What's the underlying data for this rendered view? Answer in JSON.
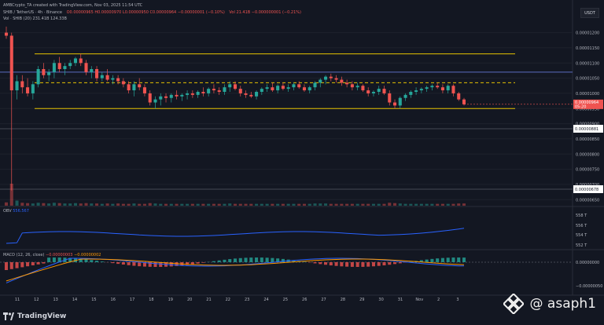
{
  "header": {
    "attribution": "AMBCrypto_TA created with TradingView.com, Nov 03, 2025 11:54 UTC",
    "symbol_line": "SHIB / TetherUS · 4h · Binance",
    "ohlc": "O0.00000965  H0.00000970  L0.00000950  C0.00000964  −0.00000001 (−0.10%)",
    "extra": "Vol 21.41B  −0.000000001 (−0.21%)",
    "vol_line": "Vol · SHIB (20)  231.41B  124.33B"
  },
  "currency_button": "USDT",
  "price_axis": {
    "ticks": [
      "0.00001200",
      "0.00001150",
      "0.00001100",
      "0.00001050",
      "0.00001000",
      "0.00000950",
      "0.00000900",
      "0.00000850",
      "0.00000800",
      "0.00000750",
      "0.00000700",
      "0.00000650"
    ],
    "current_price_label": "0.00000964",
    "current_time_label": "05:20",
    "marker_upper": "0.00000881",
    "marker_lower": "0.00000678"
  },
  "obv": {
    "label": "OBV",
    "value": "556.567",
    "ticks": [
      "558 T",
      "556 T",
      "554 T",
      "552 T"
    ]
  },
  "macd": {
    "label": "MACD (12, 26, close)",
    "value1": "−0.00000003",
    "value2": "−0.00000002",
    "zero_tick": "0.00000000",
    "low_tick": "−0.00000050"
  },
  "time_axis": [
    "11",
    "12",
    "13",
    "14",
    "15",
    "16",
    "17",
    "18",
    "19",
    "20",
    "21",
    "22",
    "23",
    "24",
    "25",
    "26",
    "27",
    "28",
    "29",
    "30",
    "31",
    "Nov",
    "2",
    "3"
  ],
  "footer": {
    "brand": "TradingView"
  },
  "watermark": {
    "handle": "@ asaph1"
  },
  "colors": {
    "up": "#26a69a",
    "down": "#ef5350",
    "level": "#e5c200",
    "blue_line": "#5c6bc0",
    "obv": "#2962ff",
    "bg": "#131722"
  },
  "chart_data": {
    "type": "candlestick",
    "title": "SHIB / TetherUS · 4h · Binance",
    "ylim": [
      6.3e-06,
      1.23e-05
    ],
    "levels": {
      "resistance_upper": 1.13e-05,
      "horizontal_blue": 1.07e-05,
      "dashed_mid": 1.035e-05,
      "support_lower": 9.5e-06
    },
    "candles": [
      [
        1.2e-05,
        1.22e-05,
        1.18e-05,
        1.19e-05
      ],
      [
        1.19e-05,
        1.2e-05,
        6.8e-06,
        1.01e-05
      ],
      [
        1.01e-05,
        1.06e-05,
        9.8e-06,
        1.04e-05
      ],
      [
        1.04e-05,
        1.06e-05,
        1e-05,
        1.02e-05
      ],
      [
        1.02e-05,
        1.05e-05,
        9.9e-06,
        1e-05
      ],
      [
        1e-05,
        1.04e-05,
        9.8e-06,
        1.03e-05
      ],
      [
        1.03e-05,
        1.09e-05,
        1.02e-05,
        1.08e-05
      ],
      [
        1.08e-05,
        1.1e-05,
        1.05e-05,
        1.06e-05
      ],
      [
        1.06e-05,
        1.08e-05,
        1.04e-05,
        1.07e-05
      ],
      [
        1.07e-05,
        1.11e-05,
        1.05e-05,
        1.1e-05
      ],
      [
        1.1e-05,
        1.12e-05,
        1.07e-05,
        1.08e-05
      ],
      [
        1.08e-05,
        1.1e-05,
        1.06e-05,
        1.09e-05
      ],
      [
        1.09e-05,
        1.11e-05,
        1.08e-05,
        1.1e-05
      ],
      [
        1.1e-05,
        1.12e-05,
        1.09e-05,
        1.115e-05
      ],
      [
        1.115e-05,
        1.13e-05,
        1.09e-05,
        1.1e-05
      ],
      [
        1.1e-05,
        1.11e-05,
        1.06e-05,
        1.07e-05
      ],
      [
        1.07e-05,
        1.09e-05,
        1.05e-05,
        1.08e-05
      ],
      [
        1.08e-05,
        1.09e-05,
        1.04e-05,
        1.05e-05
      ],
      [
        1.05e-05,
        1.07e-05,
        1.04e-05,
        1.06e-05
      ],
      [
        1.06e-05,
        1.08e-05,
        1.04e-05,
        1.045e-05
      ],
      [
        1.045e-05,
        1.06e-05,
        1.03e-05,
        1.05e-05
      ],
      [
        1.05e-05,
        1.06e-05,
        1.03e-05,
        1.04e-05
      ],
      [
        1.04e-05,
        1.05e-05,
        1.02e-05,
        1.03e-05
      ],
      [
        1.03e-05,
        1.04e-05,
        1e-05,
        1.01e-05
      ],
      [
        1.01e-05,
        1.04e-05,
        9.9e-06,
        1.03e-05
      ],
      [
        1.03e-05,
        1.05e-05,
        1.01e-05,
        1.02e-05
      ],
      [
        1.02e-05,
        1.03e-05,
        9.9e-06,
        1e-05
      ],
      [
        1e-05,
        1.01e-05,
        9.6e-06,
        9.7e-06
      ],
      [
        9.7e-06,
        9.9e-06,
        9.5e-06,
        9.8e-06
      ],
      [
        9.8e-06,
        1e-05,
        9.6e-06,
        9.9e-06
      ],
      [
        9.9e-06,
        1e-05,
        9.7e-06,
        9.85e-06
      ],
      [
        9.85e-06,
        1e-05,
        9.7e-06,
        9.95e-06
      ],
      [
        9.95e-06,
        1.01e-05,
        9.8e-06,
        9.9e-06
      ],
      [
        9.9e-06,
        1e-05,
        9.75e-06,
        9.95e-06
      ],
      [
        9.95e-06,
        1.01e-05,
        9.8e-06,
        1e-05
      ],
      [
        1e-05,
        1.01e-05,
        9.85e-06,
        9.95e-06
      ],
      [
        9.95e-06,
        1.01e-05,
        9.85e-06,
        1.005e-05
      ],
      [
        1.005e-05,
        1.02e-05,
        9.9e-06,
        1e-05
      ],
      [
        1e-05,
        1.02e-05,
        9.9e-06,
        1.015e-05
      ],
      [
        1.015e-05,
        1.03e-05,
        1e-05,
        1.01e-05
      ],
      [
        1.01e-05,
        1.02e-05,
        9.95e-06,
        1.005e-05
      ],
      [
        1.005e-05,
        1.03e-05,
        9.95e-06,
        1.02e-05
      ],
      [
        1.02e-05,
        1.04e-05,
        1.005e-05,
        1.03e-05
      ],
      [
        1.03e-05,
        1.04e-05,
        1.01e-05,
        1.015e-05
      ],
      [
        1.015e-05,
        1.025e-05,
        9.9e-06,
        1e-05
      ],
      [
        1e-05,
        1.01e-05,
        9.85e-06,
        9.95e-06
      ],
      [
        9.95e-06,
        1.005e-05,
        9.85e-06,
        9.9e-06
      ],
      [
        9.9e-06,
        1.01e-05,
        9.8e-06,
        1.005e-05
      ],
      [
        1.005e-05,
        1.02e-05,
        9.95e-06,
        1.015e-05
      ],
      [
        1.015e-05,
        1.03e-05,
        1.005e-05,
        1.02e-05
      ],
      [
        1.02e-05,
        1.035e-05,
        1.005e-05,
        1.01e-05
      ],
      [
        1.01e-05,
        1.03e-05,
        1e-05,
        1.025e-05
      ],
      [
        1.025e-05,
        1.035e-05,
        1.01e-05,
        1.015e-05
      ],
      [
        1.015e-05,
        1.03e-05,
        1.005e-05,
        1.02e-05
      ],
      [
        1.02e-05,
        1.035e-05,
        1.01e-05,
        1.03e-05
      ],
      [
        1.03e-05,
        1.04e-05,
        1.015e-05,
        1.02e-05
      ],
      [
        1.02e-05,
        1.03e-05,
        1.005e-05,
        1.01e-05
      ],
      [
        1.01e-05,
        1.025e-05,
        1e-05,
        1.02e-05
      ],
      [
        1.02e-05,
        1.04e-05,
        1.01e-05,
        1.035e-05
      ],
      [
        1.035e-05,
        1.05e-05,
        1.02e-05,
        1.045e-05
      ],
      [
        1.045e-05,
        1.06e-05,
        1.03e-05,
        1.055e-05
      ],
      [
        1.055e-05,
        1.065e-05,
        1.04e-05,
        1.05e-05
      ],
      [
        1.05e-05,
        1.06e-05,
        1.035e-05,
        1.045e-05
      ],
      [
        1.045e-05,
        1.055e-05,
        1.025e-05,
        1.035e-05
      ],
      [
        1.035e-05,
        1.045e-05,
        1.02e-05,
        1.03e-05
      ],
      [
        1.03e-05,
        1.04e-05,
        1.01e-05,
        1.02e-05
      ],
      [
        1.02e-05,
        1.035e-05,
        1.01e-05,
        1.025e-05
      ],
      [
        1.025e-05,
        1.03e-05,
        1.005e-05,
        1.01e-05
      ],
      [
        1.01e-05,
        1.02e-05,
        9.9e-06,
        1e-05
      ],
      [
        1e-05,
        1.01e-05,
        9.9e-06,
        1.005e-05
      ],
      [
        1.005e-05,
        1.025e-05,
        9.95e-06,
        1.015e-05
      ],
      [
        1.015e-05,
        1.025e-05,
        9.95e-06,
        1e-05
      ],
      [
        1e-05,
        1.01e-05,
        9.6e-06,
        9.7e-06
      ],
      [
        9.7e-06,
        9.8e-06,
        9.5e-06,
        9.6e-06
      ],
      [
        9.6e-06,
        9.9e-06,
        9.5e-06,
        9.85e-06
      ],
      [
        9.85e-06,
        1e-05,
        9.75e-06,
        9.95e-06
      ],
      [
        9.95e-06,
        1.01e-05,
        9.85e-06,
        1.005e-05
      ],
      [
        1.005e-05,
        1.02e-05,
        9.95e-06,
        1.01e-05
      ],
      [
        1.01e-05,
        1.02e-05,
        1e-05,
        1.015e-05
      ],
      [
        1.015e-05,
        1.025e-05,
        1.005e-05,
        1.02e-05
      ],
      [
        1.02e-05,
        1.03e-05,
        1.01e-05,
        1.025e-05
      ],
      [
        1.025e-05,
        1.035e-05,
        1.015e-05,
        1.02e-05
      ],
      [
        1.02e-05,
        1.03e-05,
        1e-05,
        1.01e-05
      ],
      [
        1.01e-05,
        1.03e-05,
        1e-05,
        1.025e-05
      ],
      [
        1.025e-05,
        1.03e-05,
        9.9e-06,
        1e-05
      ],
      [
        1e-05,
        1.005e-05,
        9.75e-06,
        9.8e-06
      ],
      [
        9.8e-06,
        9.85e-06,
        9.6e-06,
        9.64e-06
      ]
    ],
    "volume_note": "volume bars shown at bottom of price pane (relative heights)",
    "volume": [
      9,
      60,
      14,
      8,
      7,
      6,
      8,
      7,
      6,
      8,
      7,
      6,
      6,
      7,
      6,
      7,
      6,
      6,
      5,
      6,
      5,
      6,
      5,
      5,
      6,
      5,
      5,
      7,
      6,
      5,
      5,
      5,
      5,
      5,
      5,
      5,
      5,
      5,
      5,
      5,
      5,
      5,
      6,
      5,
      5,
      5,
      5,
      5,
      5,
      5,
      5,
      5,
      5,
      5,
      5,
      5,
      5,
      5,
      6,
      6,
      6,
      5,
      5,
      5,
      5,
      5,
      5,
      5,
      5,
      5,
      5,
      5,
      8,
      7,
      6,
      5,
      5,
      5,
      5,
      5,
      5,
      5,
      5,
      5,
      5,
      6,
      6
    ]
  }
}
